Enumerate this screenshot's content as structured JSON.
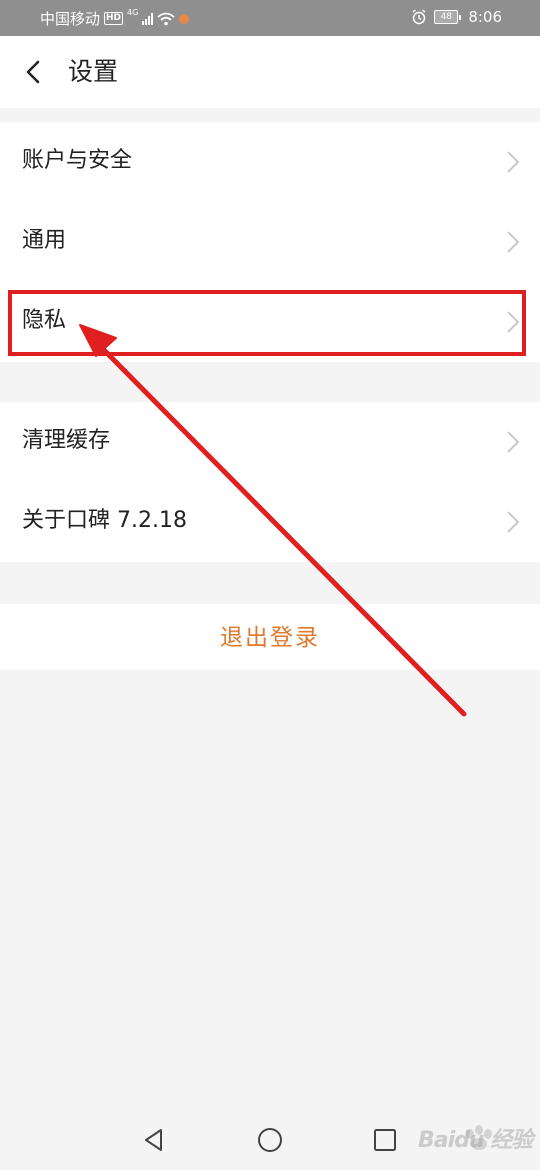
{
  "status_bar": {
    "carrier": "中国移动",
    "hd_badge": "HD",
    "network": "4G",
    "battery": "48",
    "time": "8:06"
  },
  "header": {
    "back_icon": "chevron-left-icon",
    "title": "设置"
  },
  "groups": [
    {
      "items": [
        {
          "label": "账户与安全"
        },
        {
          "label": "通用"
        },
        {
          "label": "隐私",
          "highlighted": true
        }
      ]
    },
    {
      "items": [
        {
          "label": "清理缓存"
        },
        {
          "label": "关于口碑 7.2.18"
        }
      ]
    }
  ],
  "logout": {
    "label": "退出登录",
    "color": "#e0782d"
  },
  "nav_bar": {
    "icons": [
      "back-triangle-icon",
      "home-circle-icon",
      "recents-square-icon"
    ]
  },
  "annotation": {
    "color": "#e02020",
    "target": "隐私"
  },
  "watermark": {
    "text": "Baidu 经验"
  }
}
